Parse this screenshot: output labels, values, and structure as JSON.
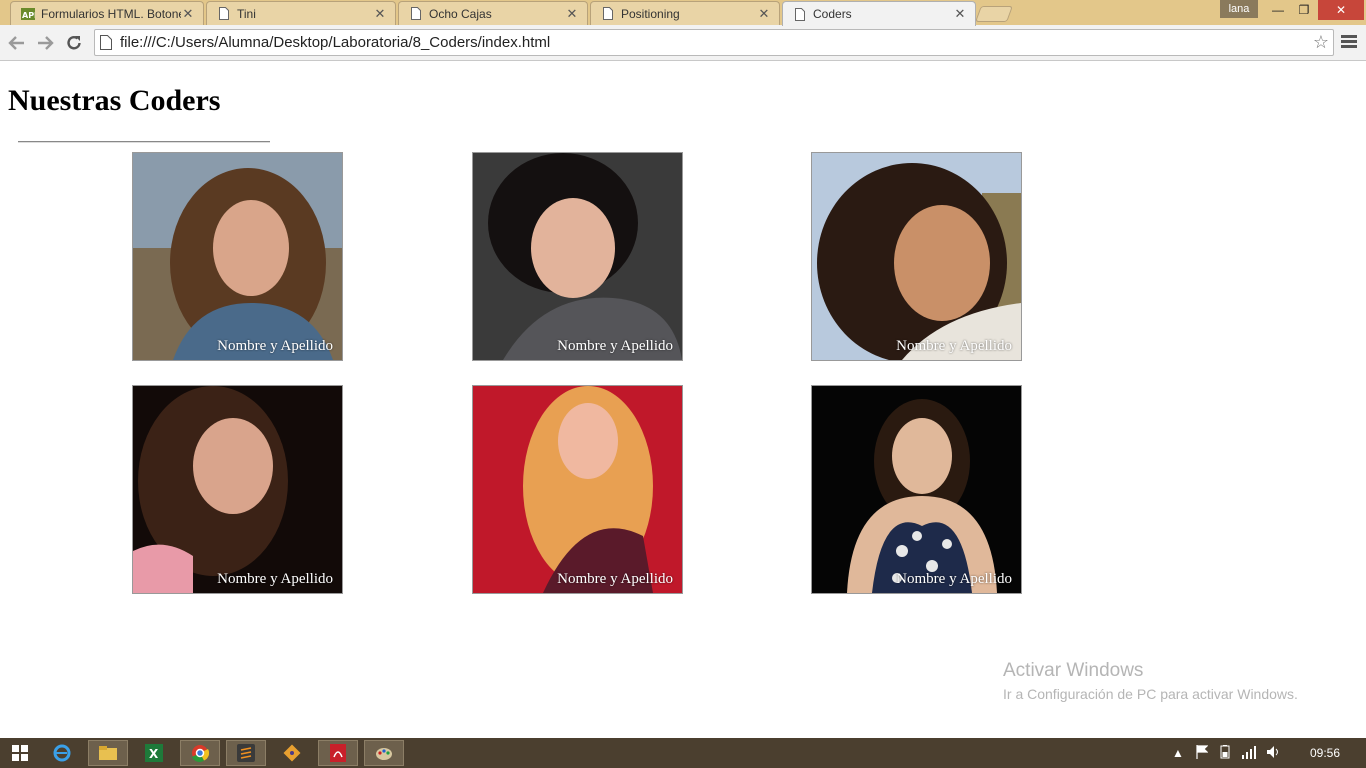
{
  "browser": {
    "tabs": [
      {
        "title": "Formularios HTML. Botone",
        "active": false
      },
      {
        "title": "Tini",
        "active": false
      },
      {
        "title": "Ocho Cajas",
        "active": false
      },
      {
        "title": "Positioning",
        "active": false
      },
      {
        "title": "Coders",
        "active": true
      }
    ],
    "user": "lana",
    "url": "file:///C:/Users/Alumna/Desktop/Laboratoria/8_Coders/index.html"
  },
  "page": {
    "title": "Nuestras Coders",
    "cards": [
      {
        "caption": "Nombre y Apellido",
        "bg": "#8a9bab",
        "hair": "#5a3a22",
        "skin": "#d9a58a",
        "top": "#4a6a8a"
      },
      {
        "caption": "Nombre y Apellido",
        "bg": "#3a3a3a",
        "hair": "#141010",
        "skin": "#e2b39b",
        "top": "#555559"
      },
      {
        "caption": "Nombre y Apellido",
        "bg": "#b8c9dd",
        "hair": "#2a1a12",
        "skin": "#c99068",
        "top": "#e8e4dc"
      },
      {
        "caption": "Nombre y Apellido",
        "bg": "#120a08",
        "hair": "#3b2216",
        "skin": "#d9a48c",
        "top": "#e89aa8"
      },
      {
        "caption": "Nombre y Apellido",
        "bg": "#c0182a",
        "hair": "#e8a052",
        "skin": "#f0b8a0",
        "top": "#5a1a2a"
      },
      {
        "caption": "Nombre y Apellido",
        "bg": "#050505",
        "hair": "#2a1a10",
        "skin": "#e0b89a",
        "top": "#1e2a4a"
      }
    ]
  },
  "watermark": {
    "line1": "Activar Windows",
    "line2": "Ir a Configuración de PC para activar Windows."
  },
  "taskbar": {
    "clock": "09:56"
  }
}
